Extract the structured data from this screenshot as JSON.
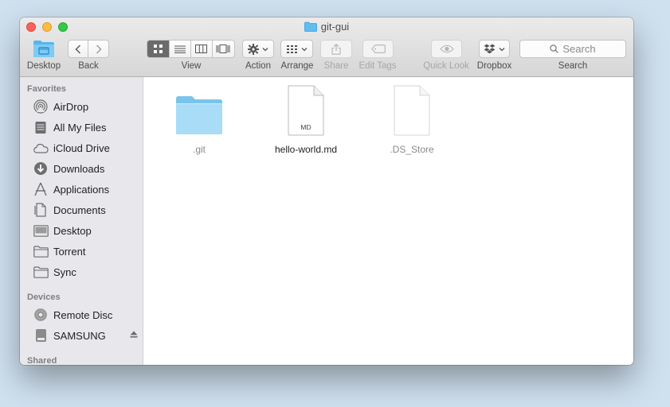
{
  "window": {
    "title": "git-gui"
  },
  "toolbar": {
    "desktop_label": "Desktop",
    "back_label": "Back",
    "view_label": "View",
    "action_label": "Action",
    "arrange_label": "Arrange",
    "share_label": "Share",
    "edit_tags_label": "Edit Tags",
    "quick_look_label": "Quick Look",
    "dropbox_label": "Dropbox",
    "search_label": "Search",
    "search_placeholder": "Search",
    "active_view": "icon"
  },
  "sidebar": {
    "favorites_title": "Favorites",
    "favorites": [
      {
        "label": "AirDrop",
        "icon": "airdrop-icon"
      },
      {
        "label": "All My Files",
        "icon": "all-files-icon"
      },
      {
        "label": "iCloud Drive",
        "icon": "cloud-icon"
      },
      {
        "label": "Downloads",
        "icon": "downloads-icon"
      },
      {
        "label": "Applications",
        "icon": "applications-icon"
      },
      {
        "label": "Documents",
        "icon": "documents-icon"
      },
      {
        "label": "Desktop",
        "icon": "desktop-icon"
      },
      {
        "label": "Torrent",
        "icon": "folder-icon"
      },
      {
        "label": "Sync",
        "icon": "folder-icon"
      }
    ],
    "devices_title": "Devices",
    "devices": [
      {
        "label": "Remote Disc",
        "icon": "disc-icon"
      },
      {
        "label": "SAMSUNG",
        "icon": "drive-icon",
        "eject": true
      }
    ],
    "shared_title": "Shared"
  },
  "files": [
    {
      "name": ".git",
      "kind": "folder",
      "hidden": true
    },
    {
      "name": "hello-world.md",
      "kind": "document",
      "badge": "MD",
      "hidden": false
    },
    {
      "name": ".DS_Store",
      "kind": "document",
      "badge": "",
      "hidden": true
    }
  ],
  "colors": {
    "folder": "#8fd0f2",
    "accent": "#3b99fc",
    "desktop": "#cfe0ef"
  }
}
